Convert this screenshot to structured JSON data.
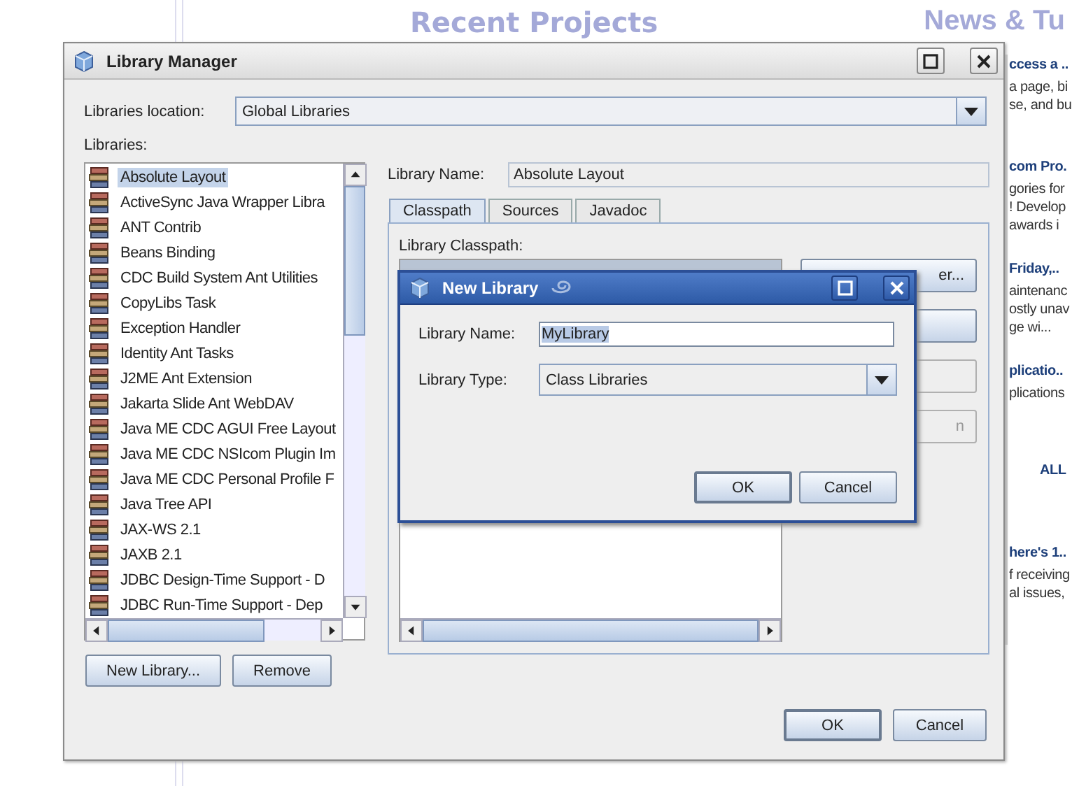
{
  "background": {
    "headings": [
      "Recent Projects",
      "News & Tu"
    ],
    "news": [
      {
        "kind": "group",
        "title": "ccess a ..",
        "lines": [
          "a page, bi",
          "se, and bu"
        ]
      },
      {
        "kind": "group",
        "title": "com Pro.",
        "lines": [
          "gories for",
          "! Develop",
          "awards i"
        ]
      },
      {
        "kind": "group",
        "title": "Friday,..",
        "lines": [
          "aintenanc",
          "ostly unav",
          "ge wi..."
        ]
      },
      {
        "kind": "group",
        "title": "plicatio..",
        "lines": [
          "plications"
        ]
      },
      {
        "kind": "link",
        "title": "ALL"
      },
      {
        "kind": "group",
        "title": "here's 1..",
        "lines": [
          "f receiving",
          "al issues,"
        ]
      }
    ]
  },
  "library_manager": {
    "title": "Library Manager",
    "location_label": "Libraries location:",
    "location_value": "Global Libraries",
    "libraries_label": "Libraries:",
    "libraries": [
      {
        "name": "Absolute Layout",
        "selected": true
      },
      {
        "name": "ActiveSync Java Wrapper Libra",
        "selected": false
      },
      {
        "name": "ANT Contrib",
        "selected": false
      },
      {
        "name": "Beans Binding",
        "selected": false
      },
      {
        "name": "CDC Build System Ant Utilities",
        "selected": false
      },
      {
        "name": "CopyLibs Task",
        "selected": false
      },
      {
        "name": "Exception Handler",
        "selected": false
      },
      {
        "name": "Identity Ant Tasks",
        "selected": false
      },
      {
        "name": "J2ME Ant Extension",
        "selected": false
      },
      {
        "name": "Jakarta Slide Ant WebDAV",
        "selected": false
      },
      {
        "name": "Java ME CDC AGUI Free Layout",
        "selected": false
      },
      {
        "name": "Java ME CDC NSIcom Plugin Im",
        "selected": false
      },
      {
        "name": "Java ME CDC Personal Profile F",
        "selected": false
      },
      {
        "name": "Java Tree API",
        "selected": false
      },
      {
        "name": "JAX-WS 2.1",
        "selected": false
      },
      {
        "name": "JAXB 2.1",
        "selected": false
      },
      {
        "name": "JDBC Design-Time Support - D",
        "selected": false
      },
      {
        "name": "JDBC Run-Time Support - Dep",
        "selected": false
      }
    ],
    "list_buttons": [
      "New Library...",
      "Remove"
    ],
    "name_label": "Library Name:",
    "name_value": "Absolute Layout",
    "tabs": [
      {
        "label": "Classpath",
        "selected": true
      },
      {
        "label": "Sources",
        "selected": false
      },
      {
        "label": "Javadoc",
        "selected": false
      }
    ],
    "classpath_label": "Library Classpath:",
    "side_buttons": [
      {
        "label": "er...",
        "disabled": false
      },
      {
        "disabled": false
      },
      {
        "disabled": true
      },
      {
        "label": "n",
        "disabled": true
      }
    ],
    "buttons": [
      "OK",
      "Cancel"
    ]
  },
  "new_library": {
    "title": "New Library",
    "name_label": "Library Name:",
    "name_value": "MyLibrary",
    "name_text_selected": true,
    "type_label": "Library Type:",
    "type_value": "Class Libraries",
    "buttons": [
      "OK",
      "Cancel"
    ]
  }
}
